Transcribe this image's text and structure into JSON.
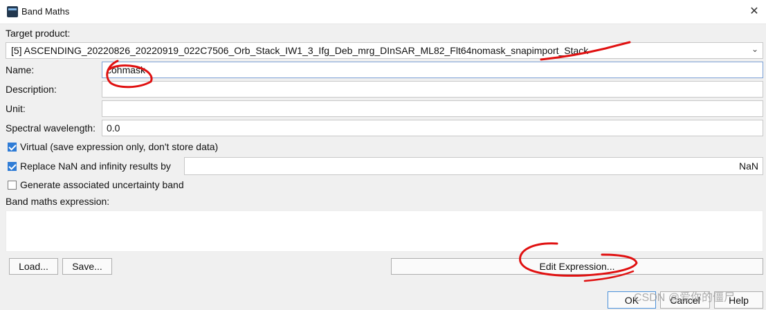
{
  "window": {
    "title": "Band Maths",
    "icon": "snap-app-icon",
    "icon_text": "SNAP",
    "close_icon": "✕"
  },
  "form": {
    "target_product_label": "Target product:",
    "target_product_value": "[5] ASCENDING_20220826_20220919_022C7506_Orb_Stack_IW1_3_Ifg_Deb_mrg_DInSAR_ML82_Flt64nomask_snapimport_Stack",
    "name_label": "Name:",
    "name_value": "cohmask",
    "description_label": "Description:",
    "description_value": "",
    "unit_label": "Unit:",
    "unit_value": "",
    "spectral_label": "Spectral wavelength:",
    "spectral_value": "0.0",
    "virtual_label": "Virtual (save expression only, don't store data)",
    "virtual_checked": true,
    "replace_nan_label": "Replace NaN and infinity results by",
    "replace_nan_checked": true,
    "replace_nan_value": "NaN",
    "uncertainty_label": "Generate associated uncertainty band",
    "uncertainty_checked": false,
    "expression_label": "Band maths expression:",
    "expression_value": ""
  },
  "buttons": {
    "load": "Load...",
    "save": "Save...",
    "edit_expression": "Edit Expression...",
    "ok": "OK",
    "cancel": "Cancel",
    "help": "Help"
  },
  "watermark": "CSDN @爱你的僵尸"
}
